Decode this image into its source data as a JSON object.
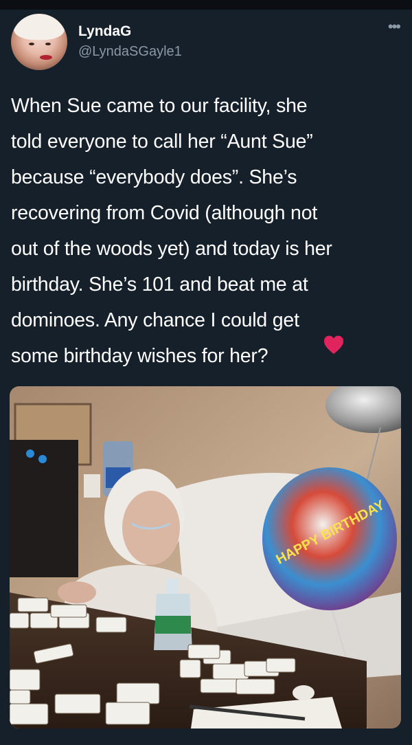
{
  "tweet": {
    "author_name": "LyndaG",
    "author_handle": "@LyndaSGayle1",
    "more_icon": "more-horizontal-icon",
    "text": "When Sue came to our facility, she\ntold everyone to call her “Aunt Sue”\nbecause “everybody does”.  She’s\nrecovering from Covid (although not\nout of the woods yet) and today is her\nbirthday. She’s 101 and beat me at\ndominoes. Any chance I could get\nsome birthday wishes for her?",
    "emoji": "red-heart-icon"
  },
  "photo": {
    "balloon_text": "HAPPY BIRTHDAY"
  },
  "colors": {
    "background": "#15202b",
    "text": "#ffffff",
    "secondary_text": "#8b98a5",
    "heart": "#e0245e"
  }
}
